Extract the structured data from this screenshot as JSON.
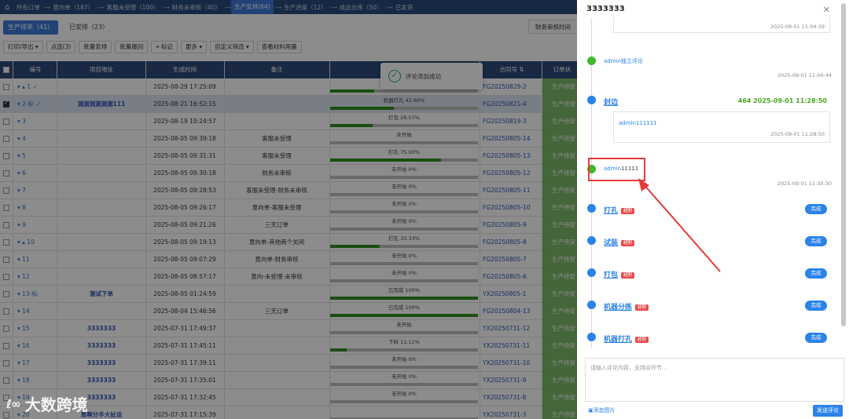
{
  "topnav": {
    "crumbs": [
      {
        "label": "所有订单",
        "active": false
      },
      {
        "label": "意向单（187）",
        "active": false
      },
      {
        "label": "客服未受理（100）",
        "active": false
      },
      {
        "label": "财务未审核（40）",
        "active": false
      },
      {
        "label": "生产安排(64)",
        "active": true
      },
      {
        "label": "生产进度（12）",
        "active": false
      },
      {
        "label": "成品仓库（50）",
        "active": false
      },
      {
        "label": "已发货",
        "active": false
      }
    ],
    "sep": "·-→"
  },
  "tabs": {
    "main": "生产排单（41）",
    "second": "已安排（23）",
    "audit": "财务审核时间"
  },
  "toolbar": {
    "print": "打印/导出",
    "selected": "点选(3)",
    "batch_arrange": "批量安排",
    "batch_return": "批量撤回",
    "mark": "标记",
    "more": "更多",
    "custom_filter": "自定义筛选",
    "material": "查看材料用量"
  },
  "table": {
    "headers": {
      "num": "编号",
      "project": "项目地址",
      "time": "生成时间",
      "note": "备注",
      "contract": "合同号",
      "status": "订单状"
    },
    "rows": [
      {
        "num": "▾  ▴ 1 ✓",
        "project": "",
        "time": "2025-08-29 17:25:09",
        "note": "",
        "progress_text": "",
        "progress": 0.3,
        "contract": "FG20250829-2",
        "status": "生产待安",
        "selected": false,
        "checked": false
      },
      {
        "num": "▾ 2-标 ✓",
        "project": "测测测测测测111",
        "time": "2025-08-21 16:52:15",
        "note": "",
        "progress_text": "机器打孔 42.86%",
        "progress": 0.4286,
        "contract": "FG20250821-4",
        "status": "生产待安",
        "selected": true,
        "checked": true
      },
      {
        "num": "▾ 3",
        "project": "",
        "time": "2025-08-19 10:24:57",
        "note": "",
        "progress_text": "打包 28.57%",
        "progress": 0.2857,
        "contract": "FG20250819-3",
        "status": "生产待安",
        "selected": false,
        "checked": false
      },
      {
        "num": "▾ 4",
        "project": "",
        "time": "2025-08-05 09:39:18",
        "note": "客服未受理",
        "progress_text": "未开始",
        "progress": 0,
        "contract": "FG20250805-14",
        "status": "生产待安",
        "selected": false,
        "checked": false
      },
      {
        "num": "▾ 5",
        "project": "",
        "time": "2025-08-05 09:31:31",
        "note": "客服未受理",
        "progress_text": "打孔 75.00%",
        "progress": 0.75,
        "contract": "FG20250805-13",
        "status": "生产待安",
        "selected": false,
        "checked": false
      },
      {
        "num": "▾ 6",
        "project": "",
        "time": "2025-08-05 09:30:18",
        "note": "财务未审核",
        "progress_text": "未开始 0%",
        "progress": 0,
        "contract": "FG20250805-12",
        "status": "生产待安",
        "selected": false,
        "checked": false
      },
      {
        "num": "▾ 7",
        "project": "",
        "time": "2025-08-05 09:28:53",
        "note": "客服未受理-财务未审核",
        "progress_text": "未开始 0%",
        "progress": 0,
        "contract": "FG20250805-11",
        "status": "生产待安",
        "selected": false,
        "checked": false
      },
      {
        "num": "▾ 8",
        "project": "",
        "time": "2025-08-05 09:26:17",
        "note": "意向单-客服未受理",
        "progress_text": "未开始 0%",
        "progress": 0,
        "contract": "FG20250805-10",
        "status": "生产待安",
        "selected": false,
        "checked": false
      },
      {
        "num": "▾ 9",
        "project": "",
        "time": "2025-08-05 09:21:26",
        "note": "三无订单",
        "progress_text": "未开始 0%",
        "progress": 0,
        "contract": "FG20250805-9",
        "status": "生产待安",
        "selected": false,
        "checked": false
      },
      {
        "num": "▾ ▴ 10",
        "project": "",
        "time": "2025-08-05 09:19:13",
        "note": "意向单-其他两个关闭",
        "progress_text": "打孔 33.33%",
        "progress": 0.3333,
        "contract": "FG20250805-8",
        "status": "生产待安",
        "selected": false,
        "checked": false
      },
      {
        "num": "▾ 11",
        "project": "",
        "time": "2025-08-05 09:07:29",
        "note": "意向单-财务审核",
        "progress_text": "未开始 0%",
        "progress": 0,
        "contract": "FG20250805-7",
        "status": "生产待安",
        "selected": false,
        "checked": false
      },
      {
        "num": "▾ 12",
        "project": "",
        "time": "2025-08-05 08:57:17",
        "note": "意向-未受理-未审核",
        "progress_text": "未开始 0%",
        "progress": 0,
        "contract": "FG20250805-6",
        "status": "生产待安",
        "selected": false,
        "checked": false
      },
      {
        "num": "▾ 13-标",
        "project": "测试下单",
        "time": "2025-08-05 01:24:59",
        "note": "",
        "progress_text": "已完成 100%",
        "progress": 1,
        "contract": "YX20250805-1",
        "status": "生产待安",
        "selected": false,
        "checked": false
      },
      {
        "num": "▾ 14",
        "project": "",
        "time": "2025-08-04 15:46:56",
        "note": "三无订单",
        "progress_text": "已完成 100%",
        "progress": 1,
        "contract": "FG20250804-13",
        "status": "生产待安",
        "selected": false,
        "checked": false
      },
      {
        "num": "▾ 15",
        "project": "3333333",
        "time": "2025-07-31 17:49:37",
        "note": "",
        "progress_text": "未开始",
        "progress": 0,
        "contract": "YX20250731-12",
        "status": "生产待安",
        "selected": false,
        "checked": false
      },
      {
        "num": "▾ 16",
        "project": "3333333",
        "time": "2025-07-31 17:45:11",
        "note": "",
        "progress_text": "下料 11.11%",
        "progress": 0.1111,
        "contract": "YX20250731-11",
        "status": "生产待安",
        "selected": false,
        "checked": false
      },
      {
        "num": "▾ 17",
        "project": "3333333",
        "time": "2025-07-31 17:39:11",
        "note": "",
        "progress_text": "未开始 0%",
        "progress": 0,
        "contract": "YX20250731-10",
        "status": "生产待安",
        "selected": false,
        "checked": false
      },
      {
        "num": "▾ 18",
        "project": "3333333",
        "time": "2025-07-31 17:35:01",
        "note": "",
        "progress_text": "未开始 0%",
        "progress": 0,
        "contract": "YX20250731-9",
        "status": "生产待安",
        "selected": false,
        "checked": false
      },
      {
        "num": "▾ 19",
        "project": "3333333",
        "time": "2025-07-31 17:32:45",
        "note": "",
        "progress_text": "未开始 0%",
        "progress": 0,
        "contract": "YX20250731-8",
        "status": "生产待安",
        "selected": false,
        "checked": false
      },
      {
        "num": "▾ 20",
        "project": "是啊分手大扯话",
        "time": "2025-07-31 17:15:39",
        "note": "",
        "progress_text": "",
        "progress": 0,
        "contract": "YX20250731-3",
        "status": "生产待安",
        "selected": false,
        "checked": false
      }
    ]
  },
  "toast": {
    "text": "评论添加成功"
  },
  "panel": {
    "title": "3333333",
    "top_box_time": "2025-09-01 11:04:39",
    "entry1": {
      "text": "admin独立评论",
      "time": "2025-09-01 11:04:44"
    },
    "entry2": {
      "title": "封边",
      "mark": "464 2025-09-01 11:28:50",
      "reply_user": "admin111111",
      "reply_time": "2025-09-01 11:28:50"
    },
    "entry3": {
      "user": "admin",
      "text": "11111",
      "time": "2025-09-01 11:30:30"
    },
    "steps": [
      {
        "title": "打孔",
        "tag": "超期",
        "badge": "完成"
      },
      {
        "title": "试装",
        "tag": "超期",
        "badge": "完成"
      },
      {
        "title": "打包",
        "tag": "超期",
        "badge": "完成"
      },
      {
        "title": "机器分拣",
        "tag": "超期",
        "badge": "完成"
      },
      {
        "title": "机器打孔",
        "tag": "超期",
        "badge": "完成"
      }
    ],
    "comment_placeholder": "请输入评论内容，支持@环节...",
    "add_image": "添加图片",
    "submit": "发送评论"
  },
  "watermark": {
    "logo": "ℓ∞",
    "text": "大数跨境"
  },
  "colors": {
    "accent": "#2b82e8",
    "nav": "#2a4a7c",
    "status": "#7fba6a",
    "highlight": "#e53a3a"
  }
}
